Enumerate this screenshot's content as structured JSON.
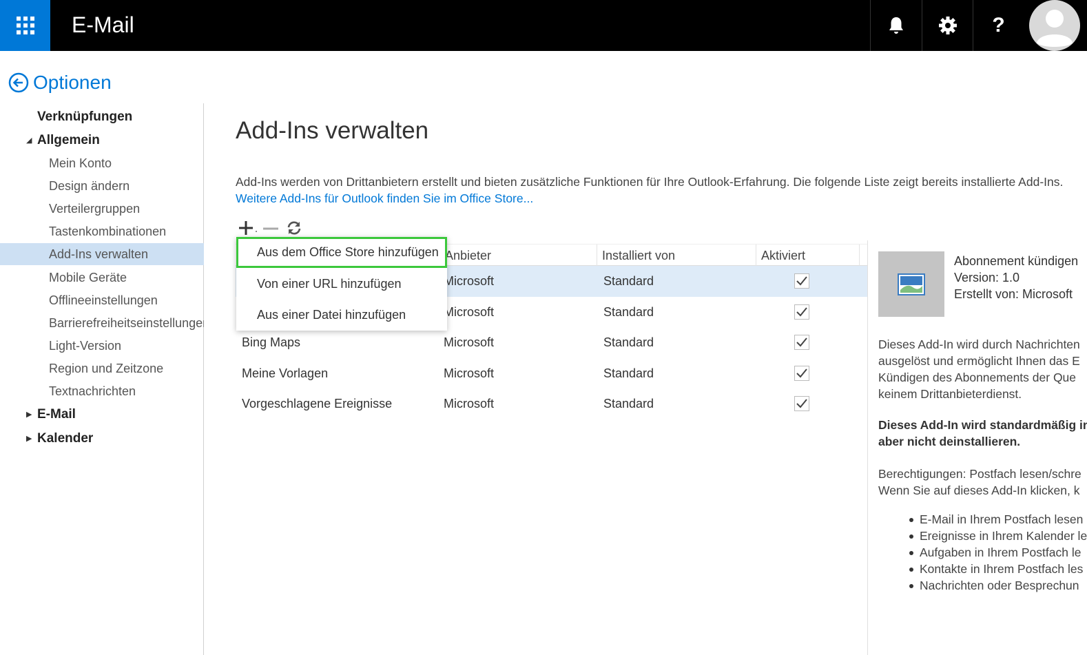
{
  "topbar": {
    "app_title": "E-Mail",
    "colors": {
      "bar": "#000000",
      "accent": "#0078d7"
    },
    "icons": [
      "app-launcher-icon",
      "bell-icon",
      "gear-icon",
      "help-icon",
      "user-avatar-icon"
    ],
    "help_label": "?"
  },
  "nav": {
    "back_title": "Optionen",
    "items": [
      {
        "label": "Verknüpfungen",
        "level": 0
      },
      {
        "label": "Allgemein",
        "level": 0,
        "expanded": true
      },
      {
        "label": "Mein Konto",
        "level": 1
      },
      {
        "label": "Design ändern",
        "level": 1
      },
      {
        "label": "Verteilergruppen",
        "level": 1
      },
      {
        "label": "Tastenkombinationen",
        "level": 1
      },
      {
        "label": "Add-Ins verwalten",
        "level": 1,
        "selected": true
      },
      {
        "label": "Mobile Geräte",
        "level": 1
      },
      {
        "label": "Offlineeinstellungen",
        "level": 1
      },
      {
        "label": "Barrierefreiheitseinstellungen",
        "level": 1
      },
      {
        "label": "Light-Version",
        "level": 1
      },
      {
        "label": "Region und Zeitzone",
        "level": 1
      },
      {
        "label": "Textnachrichten",
        "level": 1
      },
      {
        "label": "E-Mail",
        "level": 0,
        "expanded": false
      },
      {
        "label": "Kalender",
        "level": 0,
        "expanded": false
      }
    ]
  },
  "main": {
    "title": "Add-Ins verwalten",
    "description": "Add-Ins werden von Drittanbietern erstellt und bieten zusätzliche Funktionen für Ihre Outlook-Erfahrung. Die folgende Liste zeigt bereits installierte Add-Ins. ",
    "store_link": "Weitere Add-Ins für Outlook finden Sie im Office Store...",
    "toolbar_icons": [
      "add-icon",
      "remove-icon",
      "refresh-icon"
    ],
    "table": {
      "headers": [
        "Anbieter",
        "Installiert von",
        "Aktiviert"
      ],
      "rows": [
        {
          "name": "",
          "provider": "Microsoft",
          "installed_by": "Standard",
          "enabled": true,
          "selected": true
        },
        {
          "name": "",
          "provider": "Microsoft",
          "installed_by": "Standard",
          "enabled": true
        },
        {
          "name": "Bing Maps",
          "provider": "Microsoft",
          "installed_by": "Standard",
          "enabled": true
        },
        {
          "name": "Meine Vorlagen",
          "provider": "Microsoft",
          "installed_by": "Standard",
          "enabled": true
        },
        {
          "name": "Vorgeschlagene Ereignisse",
          "provider": "Microsoft",
          "installed_by": "Standard",
          "enabled": true
        }
      ]
    },
    "dropdown": {
      "items": [
        "Aus dem Office Store hinzufügen",
        "Von einer URL hinzufügen",
        "Aus einer Datei hinzufügen"
      ],
      "highlight_color": "#3cc83c"
    }
  },
  "detail": {
    "name": "Abonnement kündigen",
    "version": "Version: 1.0",
    "created_by": "Erstellt von: Microsoft",
    "para1": [
      "Dieses Add-In wird durch Nachrichten",
      "ausgelöst und ermöglicht Ihnen das E",
      "Kündigen des Abonnements der Que",
      "keinem Drittanbieterdienst."
    ],
    "para2": [
      "Dieses Add-In wird standardmäßig in",
      "aber nicht deinstallieren."
    ],
    "para3": [
      "Berechtigungen: Postfach lesen/schre",
      "Wenn Sie auf dieses Add-In klicken, k"
    ],
    "permissions": [
      "E-Mail in Ihrem Postfach lesen",
      "Ereignisse in Ihrem Kalender le",
      "Aufgaben in Ihrem Postfach le",
      "Kontakte in Ihrem Postfach les",
      "Nachrichten oder Besprechun"
    ]
  }
}
